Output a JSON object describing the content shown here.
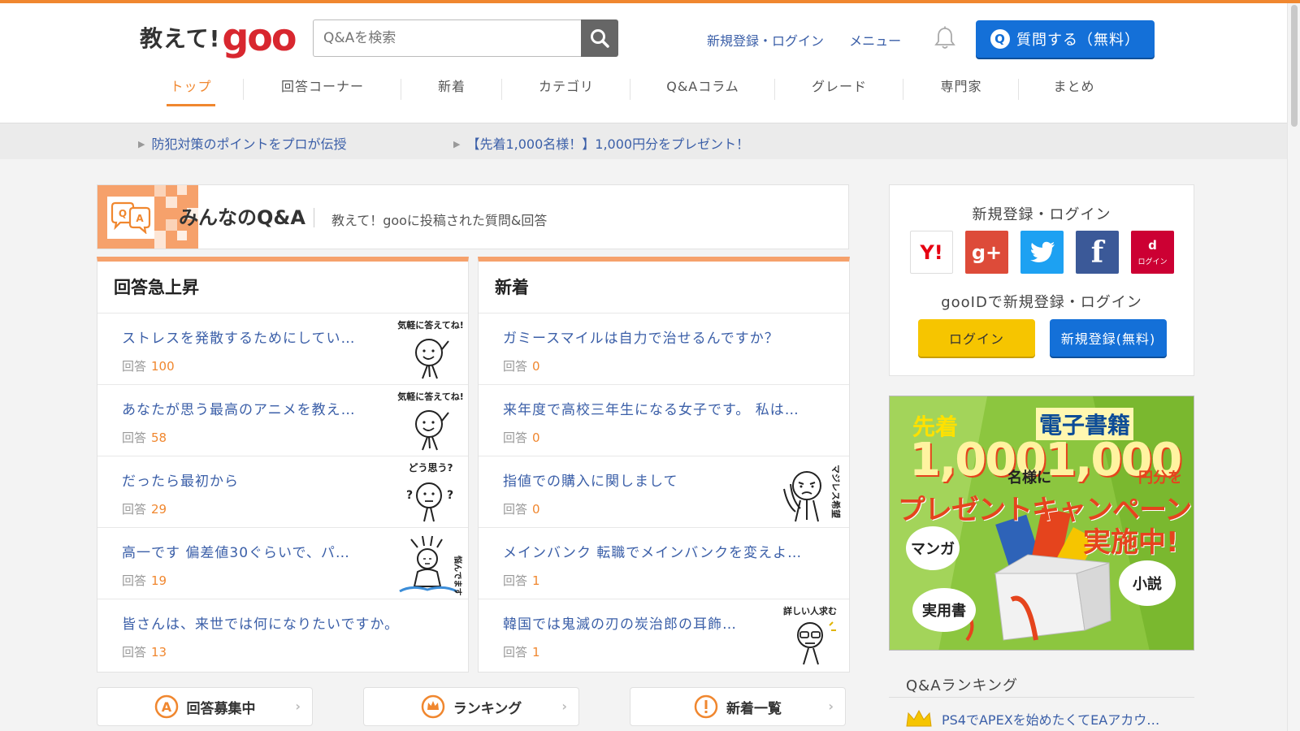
{
  "header": {
    "logo_text": "教えて!",
    "logo_goo": "goo",
    "search_placeholder": "Q&Aを検索",
    "links": [
      "新規登録・ログイン",
      "メニュー"
    ],
    "ask_button": "質問する（無料）",
    "ask_icon_letter": "Q"
  },
  "nav": [
    "トップ",
    "回答コーナー",
    "新着",
    "カテゴリ",
    "Q&Aコラム",
    "グレード",
    "専門家",
    "まとめ"
  ],
  "notices": [
    "防犯対策のポイントをプロが伝授",
    "【先着1,000名様！】1,000円分をプレゼント！"
  ],
  "qa_header": {
    "title": "みんなのQ&A",
    "subtitle": "教えて！gooに投稿された質問&回答",
    "icon_text": "QA"
  },
  "answer_label": "回答",
  "rising": {
    "title": "回答急上昇",
    "items": [
      {
        "title": "ストレスを発散するためにしてい…",
        "count": "100",
        "badge": "気軽に答えてね!"
      },
      {
        "title": "あなたが思う最高のアニメを教え…",
        "count": "58",
        "badge": "気軽に答えてね!"
      },
      {
        "title": "だったら最初から",
        "count": "29",
        "badge": "どう思う?"
      },
      {
        "title": "高一です 偏差値30ぐらいで、パ…",
        "count": "19",
        "badge": "悩んでます"
      },
      {
        "title": "皆さんは、来世では何になりたいですか。",
        "count": "13",
        "badge": ""
      }
    ]
  },
  "newest": {
    "title": "新着",
    "items": [
      {
        "title": "ガミースマイルは自力で治せるんですか？",
        "count": "0",
        "badge": ""
      },
      {
        "title": "来年度で高校三年生になる女子です。 私は…",
        "count": "0",
        "badge": ""
      },
      {
        "title": "指値での購入に関しまして",
        "count": "0",
        "badge": "マジレス希望"
      },
      {
        "title": "メインバンク 転職でメインバンクを変えよ…",
        "count": "1",
        "badge": ""
      },
      {
        "title": "韓国では鬼滅の刃の炭治郎の耳飾…",
        "count": "1",
        "badge": "詳しい人求む"
      }
    ]
  },
  "bottom_links": [
    "回答募集中",
    "ランキング",
    "新着一覧"
  ],
  "login_box": {
    "title": "新規登録・ログイン",
    "socials": [
      "Y!",
      "g+",
      "twitter",
      "f",
      "d"
    ],
    "docomo_label": "ログイン",
    "gooid_title": "gooIDで新規登録・ログイン",
    "login_btn": "ログイン",
    "register_btn": "新規登録(無料)"
  },
  "banner": {
    "first": "先着",
    "ebook": "電子書籍",
    "big": "1,0001,000",
    "people": "名様に",
    "yen": "円分を",
    "campaign": "プレゼントキャンペーン",
    "now": "実施中!",
    "manga": "マンガ",
    "novel": "小説",
    "practical": "実用書"
  },
  "ranking": {
    "title": "Q&Aランキング",
    "first_item": "PS4でAPEXを始めたくてEAアカウ…"
  },
  "colors": {
    "accent": "#f0872f",
    "link": "#3b5fa8",
    "primary_button": "#1470d8",
    "login_yellow": "#f6c500",
    "register_blue": "#1470d8"
  }
}
